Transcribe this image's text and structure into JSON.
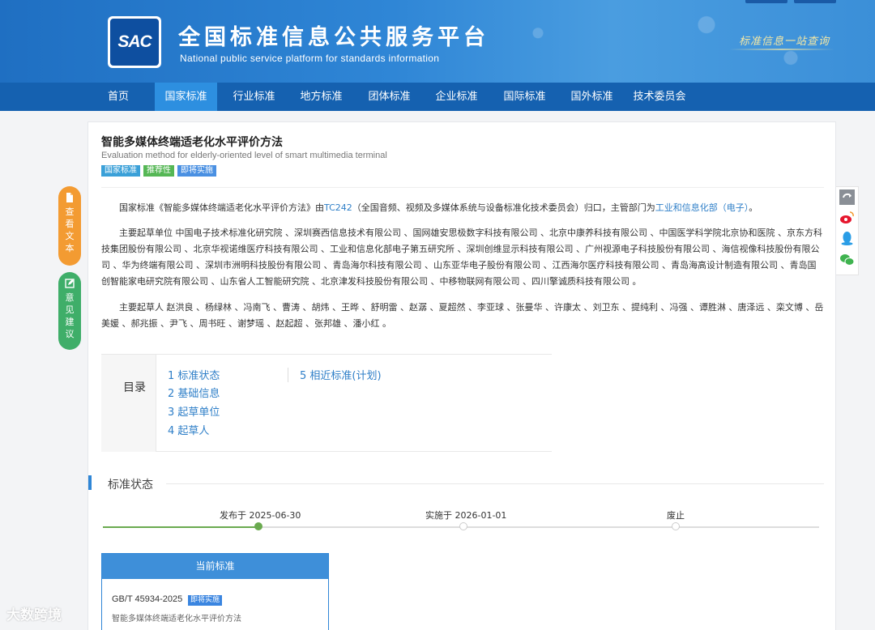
{
  "header": {
    "logo_text": "SAC",
    "title": "全国标准信息公共服务平台",
    "subtitle": "National public service platform  for standards information",
    "slogan": "标准信息一站查询"
  },
  "nav": {
    "items": [
      "首页",
      "国家标准",
      "行业标准",
      "地方标准",
      "团体标准",
      "企业标准",
      "国际标准",
      "国外标准",
      "技术委员会"
    ],
    "active": "国家标准"
  },
  "standard": {
    "title_cn": "智能多媒体终端适老化水平评价方法",
    "title_en": "Evaluation method for elderly-oriented level of smart multimedia terminal",
    "tags": [
      "国家标准",
      "推荐性",
      "即将实施"
    ],
    "intro_prefix": "国家标准《智能多媒体终端适老化水平评价方法》由",
    "committee_code": "TC242",
    "intro_middle": "（全国音频、视频及多媒体系统与设备标准化技术委员会）归口，主管部门为",
    "authority": "工业和信息化部（电子）",
    "intro_suffix": "。",
    "drafting_units": "主要起草单位 中国电子技术标准化研究院 、深圳赛西信息技术有限公司 、国网雄安思极数字科技有限公司 、北京中康养科技有限公司 、中国医学科学院北京协和医院 、京东方科技集团股份有限公司 、北京华视诺维医疗科技有限公司 、工业和信息化部电子第五研究所 、深圳创维显示科技有限公司 、广州视源电子科技股份有限公司 、海信视像科技股份有限公司 、华为终端有限公司 、深圳市洲明科技股份有限公司 、青岛海尔科技有限公司 、山东亚华电子股份有限公司 、江西海尔医疗科技有限公司 、青岛海高设计制造有限公司 、青岛国创智能家电研究院有限公司 、山东省人工智能研究院 、北京津发科技股份有限公司 、中移物联网有限公司 、四川擎诚质科技有限公司 。",
    "drafters": "主要起草人 赵洪良 、杨绿林 、冯南飞 、曹涛 、胡炜 、王晔 、舒明雷 、赵潺 、夏超然 、李亚球 、张曼华 、许康太 、刘卫东 、提纯利 、冯强 、谭胜淋 、唐泽远 、栾文博 、岳美媛 、郝兆振 、尹飞 、周书旺 、谢梦瑶 、赵起超 、张邦雄 、潘小红 。"
  },
  "toc": {
    "title": "目录",
    "links": [
      "1  标准状态",
      "2  基础信息",
      "3  起草单位",
      "4  起草人",
      "5  相近标准(计划)"
    ]
  },
  "status": {
    "section_title": "标准状态",
    "timeline": [
      {
        "label": "发布于 2025-06-30",
        "done": true
      },
      {
        "label": "实施于 2026-01-01",
        "done": false
      },
      {
        "label": "废止",
        "done": false
      }
    ],
    "current_box_title": "当前标准",
    "current_code": "GB/T 45934-2025",
    "current_tag": "即将实施",
    "current_name": "智能多媒体终端适老化水平评价方法"
  },
  "side": {
    "view_text": [
      "查",
      "看",
      "文",
      "本"
    ],
    "feedback_text": [
      "意",
      "见",
      "建",
      "议"
    ]
  },
  "watermark": "大数跨境",
  "colors": {
    "header_blue": "#2f86d6",
    "nav_blue": "#1561b0",
    "link_blue": "#2f7fc8",
    "orange": "#f39b32",
    "green": "#3fae69"
  }
}
